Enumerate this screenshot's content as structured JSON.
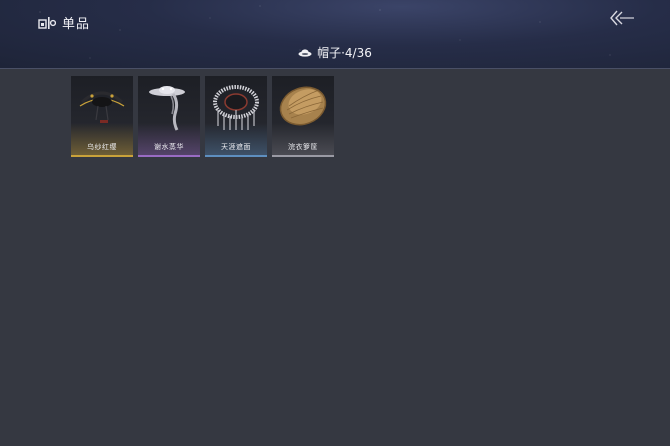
{
  "header": {
    "title": "单品",
    "title_icon": "item-icon",
    "back_icon": "back-arrow-icon"
  },
  "category": {
    "icon": "hat-icon",
    "name": "帽子·4/36"
  },
  "items": [
    {
      "name": "乌纱红缨",
      "rarity_color": "#c9a23a",
      "icon": "official-hat-icon"
    },
    {
      "name": "谢水蒸华",
      "rarity_color": "#9a6cc4",
      "icon": "veil-hat-icon"
    },
    {
      "name": "天涯遮面",
      "rarity_color": "#5e8fc0",
      "icon": "bead-curtain-hat-icon"
    },
    {
      "name": "浣衣箩筐",
      "rarity_color": "#9a9aa4",
      "icon": "basket-icon"
    }
  ]
}
